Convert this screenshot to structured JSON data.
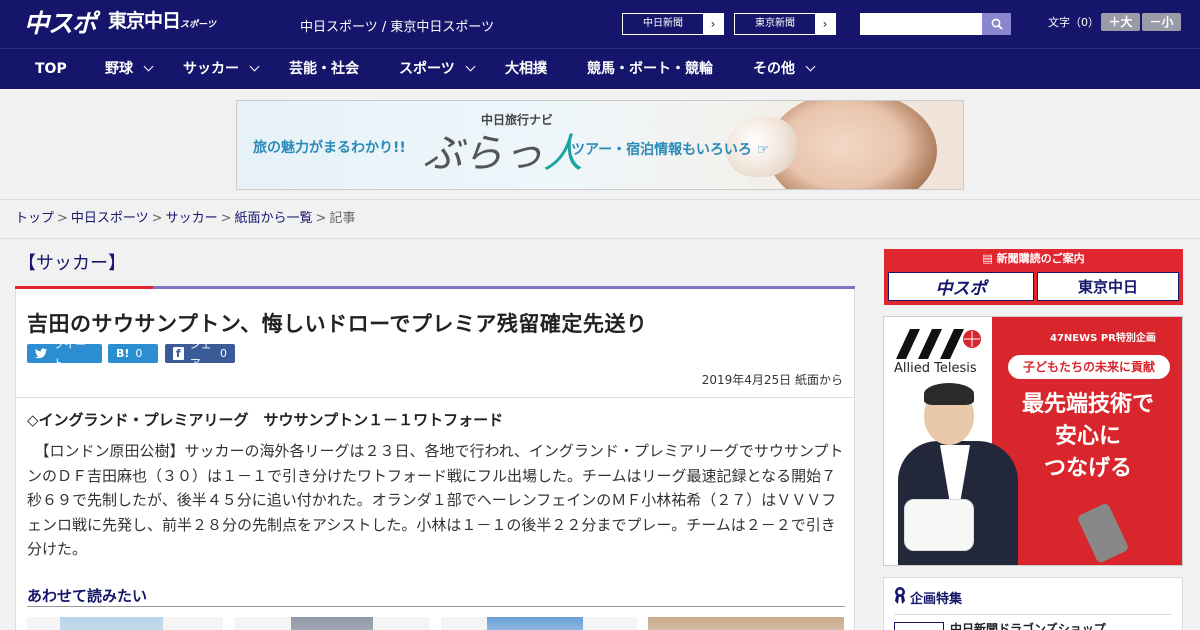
{
  "header": {
    "logo_main": "中スポ",
    "logo_sub": "東京中日",
    "logo_sub_small": "スポーツ",
    "site_names": "中日スポーツ / 東京中日スポーツ",
    "ext_links": [
      {
        "label": "中日新聞"
      },
      {
        "label": "東京新聞"
      }
    ],
    "search": {
      "value": "",
      "placeholder": ""
    },
    "font_size_label": "文字（0）",
    "font_plus": "＋大",
    "font_minus": "－小"
  },
  "nav": {
    "items": [
      {
        "label": "TOP",
        "has_menu": false
      },
      {
        "label": "野球",
        "has_menu": true
      },
      {
        "label": "サッカー",
        "has_menu": true
      },
      {
        "label": "芸能・社会",
        "has_menu": false
      },
      {
        "label": "スポーツ",
        "has_menu": true
      },
      {
        "label": "大相撲",
        "has_menu": false
      },
      {
        "label": "競馬・ボート・競輪",
        "has_menu": false
      },
      {
        "label": "その他",
        "has_menu": true
      }
    ]
  },
  "banner": {
    "left_text": "旅の魅力がまるわかり!!",
    "brand_sub": "中日旅行ナビ",
    "brand_a": "ぶらっ",
    "brand_b": "人",
    "right_text": "ツアー・宿泊情報もいろいろ"
  },
  "breadcrumb": {
    "items": [
      "トップ",
      "中日スポーツ",
      "サッカー",
      "紙面から一覧"
    ],
    "current": "記事"
  },
  "article": {
    "section": "【サッカー】",
    "title": "吉田のサウサンプトン、悔しいドローでプレミア残留確定先送り",
    "share": {
      "tweet": "ツイート",
      "hatena_icon": "B!",
      "hatena_count": "0",
      "facebook": "シェア",
      "facebook_count": "0"
    },
    "date": "2019年4月25日 紙面から",
    "subheading": "◇イングランド・プレミアリーグ　サウサンプトン１－１ワトフォード",
    "body": "　【ロンドン原田公樹】サッカーの海外各リーグは２３日、各地で行われ、イングランド・プレミアリーグでサウサンプトンのＤＦ吉田麻也（３０）は１－１で引き分けたワトフォード戦にフル出場した。チームはリーグ最速記録となる開始７秒６９で先制したが、後半４５分に追い付かれた。オランダ１部でヘーレンフェインのＭＦ小林祐希（２７）はＶＶＶフェンロ戦に先発し、前半２８分の先制点をアシストした。小林は１－１の後半２２分までプレー。チームは２－２で引き分けた。",
    "related_title": "あわせて読みたい"
  },
  "sidebar": {
    "subscription": {
      "header": "新聞購読のご案内",
      "btn1": "中スポ",
      "btn2": "東京中日"
    },
    "ad": {
      "company": "Allied Telesis",
      "pr_label": "47NEWS PR特別企画",
      "pill": "子どもたちの未来に貢献",
      "headline_lines": [
        "最先端技術で",
        "安心に",
        "つなげる"
      ]
    },
    "feature": {
      "title": "企画特集",
      "first_item": "中日新聞ドラゴンズショップ"
    }
  },
  "colors": {
    "header_bg": "#15166b",
    "accent_red": "#e0262e",
    "section_line": "#7b74c2",
    "twitter": "#2a8ed0",
    "facebook": "#3a5a98"
  }
}
